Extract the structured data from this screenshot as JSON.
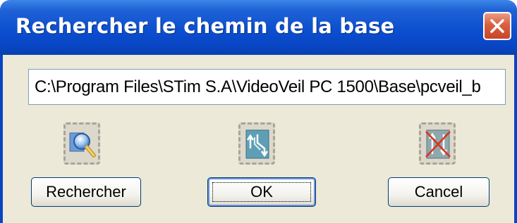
{
  "window": {
    "title": "Rechercher le chemin de la base",
    "close_icon": "close-x-icon"
  },
  "path_field": {
    "value": "C:\\Program Files\\STim S.A\\VideoVeil PC 1500\\Base\\pcveil_b"
  },
  "actions": [
    {
      "id": "search",
      "label": "Rechercher",
      "icon": "magnifier-search-icon"
    },
    {
      "id": "ok",
      "label": "OK",
      "icon": "up-down-arrows-icon",
      "default": true
    },
    {
      "id": "cancel",
      "label": "Cancel",
      "icon": "crossed-out-arrows-icon"
    }
  ],
  "colors": {
    "titlebar": "#0845c4",
    "dialog_background": "#ece9d8",
    "close_button": "#d8603f"
  }
}
